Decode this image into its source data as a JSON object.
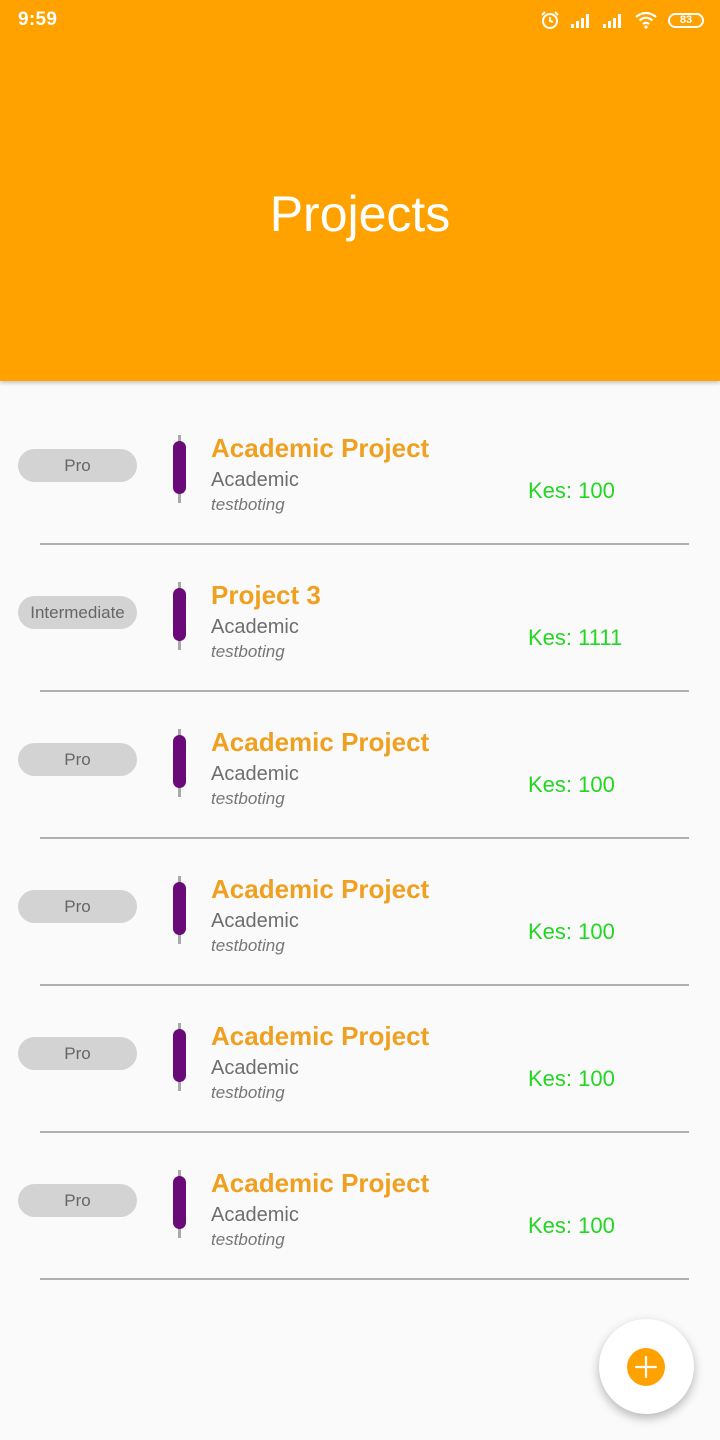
{
  "status_bar": {
    "time": "9:59",
    "battery": "83",
    "icons": [
      "alarm-icon",
      "signal-icon",
      "signal-icon",
      "wifi-icon",
      "battery-icon"
    ]
  },
  "header": {
    "title": "Projects",
    "color": "#ffa200"
  },
  "projects": [
    {
      "level": "Pro",
      "title": "Academic Project",
      "category": "Academic",
      "user": "testboting",
      "price": "Kes: 100"
    },
    {
      "level": "Intermediate",
      "title": "Project 3",
      "category": "Academic",
      "user": "testboting",
      "price": "Kes: 1111"
    },
    {
      "level": "Pro",
      "title": "Academic Project",
      "category": "Academic",
      "user": "testboting",
      "price": "Kes: 100"
    },
    {
      "level": "Pro",
      "title": "Academic Project",
      "category": "Academic",
      "user": "testboting",
      "price": "Kes: 100"
    },
    {
      "level": "Pro",
      "title": "Academic Project",
      "category": "Academic",
      "user": "testboting",
      "price": "Kes: 100"
    },
    {
      "level": "Pro",
      "title": "Academic Project",
      "category": "Academic",
      "user": "testboting",
      "price": "Kes: 100"
    }
  ],
  "colors": {
    "accent": "#ffa200",
    "title_text": "#f0a020",
    "price_text": "#22d622",
    "marker": "#6a0a78"
  },
  "fab": {
    "icon": "plus-icon"
  }
}
